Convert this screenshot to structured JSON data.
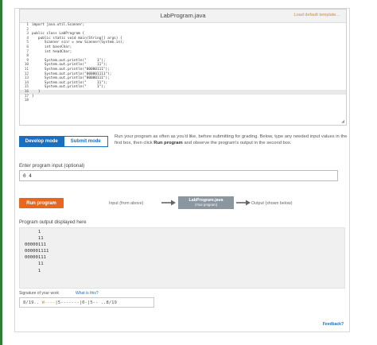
{
  "editor": {
    "file_name": "LabProgram.java",
    "load_template_label": "Load default template...",
    "lines": [
      {
        "num": "1",
        "text": "import java.util.Scanner;"
      },
      {
        "num": "2",
        "text": ""
      },
      {
        "num": "3",
        "text": "public class LabProgram {"
      },
      {
        "num": "4",
        "text": "   public static void main(String[] args) {"
      },
      {
        "num": "5",
        "text": "      Scanner scnr = new Scanner(System.in);"
      },
      {
        "num": "6",
        "text": "      int baseChar;"
      },
      {
        "num": "7",
        "text": "      int headChar;"
      },
      {
        "num": "8",
        "text": ""
      },
      {
        "num": "9",
        "text": "      System.out.println(\"     1\");"
      },
      {
        "num": "10",
        "text": "      System.out.println(\"     11\");"
      },
      {
        "num": "11",
        "text": "      System.out.println(\"00000111\");"
      },
      {
        "num": "12",
        "text": "      System.out.println(\"000001111\");"
      },
      {
        "num": "13",
        "text": "      System.out.println(\"00000111\");"
      },
      {
        "num": "14",
        "text": "      System.out.println(\"     11\");"
      },
      {
        "num": "15",
        "text": "      System.out.println(\"     1\");"
      },
      {
        "num": "16",
        "text": "   }"
      },
      {
        "num": "17",
        "text": "}"
      },
      {
        "num": "18",
        "text": ""
      }
    ],
    "active_line_index": 15
  },
  "modes": {
    "develop_label": "Develop mode",
    "submit_label": "Submit mode",
    "active": "develop"
  },
  "instructions": {
    "part1": "Run your program as often as you'd like, before submitting for grading. Below, type any needed input values in the first box, then click ",
    "bold": "Run program",
    "part2": " and observe the program's output in the second box."
  },
  "program_input": {
    "label": "Enter program input (optional)",
    "value": "0 4"
  },
  "run": {
    "button_label": "Run program",
    "input_from_label": "Input (from above)",
    "program_title": "LabProgram.java",
    "program_subtitle": "(Your program)",
    "output_to_label": "Output (shown below)"
  },
  "output": {
    "label": "Program output displayed here",
    "lines": [
      "     1",
      "     11",
      "00000111",
      "000001111",
      "00000111",
      "     11",
      "     1"
    ]
  },
  "signature": {
    "label": "Signature of your work",
    "link_label": "What is this?",
    "prefix": "8/19.. ",
    "orange": "W----",
    "rest": "|5-------|0-|5-- ..8/19"
  },
  "feedback_label": "Feedback?",
  "colors": {
    "accent_blue": "#1a6fc0",
    "run_orange": "#e8661d",
    "template_orange": "#e0892a",
    "flow_box_gray": "#8a96a0"
  }
}
